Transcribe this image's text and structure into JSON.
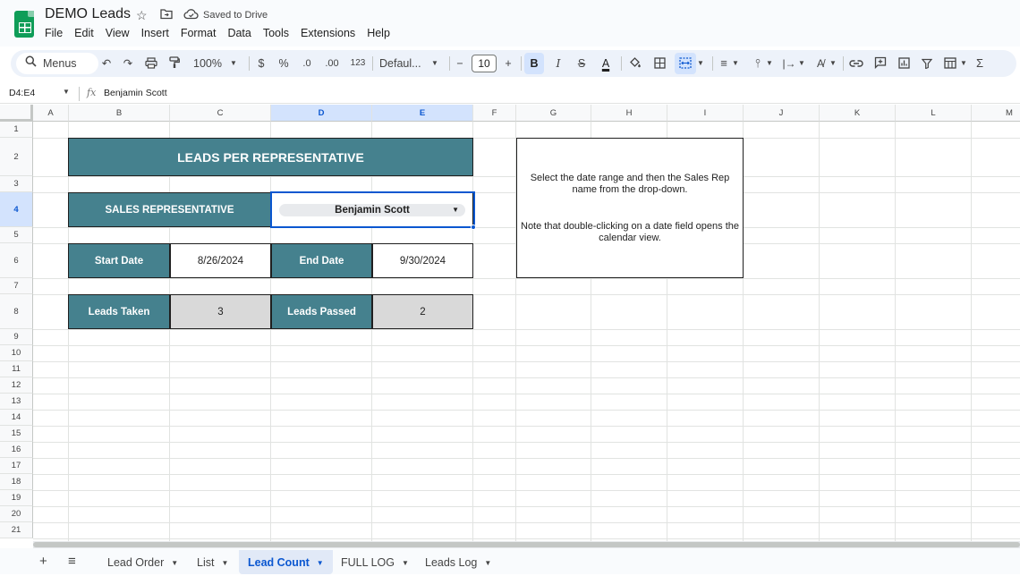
{
  "app": {
    "title": "DEMO Leads",
    "saved_status": "Saved to Drive",
    "icons": [
      "sheets-logo-icon",
      "star-icon",
      "move-folder-icon",
      "cloud-saved-icon"
    ]
  },
  "menu": [
    "File",
    "Edit",
    "View",
    "Insert",
    "Format",
    "Data",
    "Tools",
    "Extensions",
    "Help"
  ],
  "toolbar": {
    "search_label": "Menus",
    "zoom": "100%",
    "currency": "$",
    "percent": "%",
    "dec_decrease": ".0",
    "dec_increase": ".00",
    "number_format": "123",
    "font": "Defaul...",
    "font_size": "10",
    "minus": "−",
    "plus": "+",
    "bold": "B",
    "italic": "I",
    "strike": "S",
    "text_color": "A",
    "sum": "Σ"
  },
  "formula_bar": {
    "name_box": "D4:E4",
    "fx": "fx",
    "value": "Benjamin Scott"
  },
  "columns": [
    "A",
    "B",
    "C",
    "D",
    "E",
    "F",
    "G",
    "H",
    "I",
    "J",
    "K",
    "L",
    "M"
  ],
  "selected_columns": [
    "D",
    "E"
  ],
  "rows": [
    "1",
    "2",
    "3",
    "4",
    "5",
    "6",
    "7",
    "8",
    "9",
    "10",
    "11",
    "12",
    "13",
    "14",
    "15",
    "16",
    "17",
    "18",
    "19",
    "20",
    "21"
  ],
  "selected_row": "4",
  "dashboard": {
    "title": "LEADS PER REPRESENTATIVE",
    "rep_label": "SALES REPRESENTATIVE",
    "rep_value": "Benjamin Scott",
    "start_label": "Start Date",
    "start_value": "8/26/2024",
    "end_label": "End Date",
    "end_value": "9/30/2024",
    "taken_label": "Leads Taken",
    "taken_value": "3",
    "passed_label": "Leads Passed",
    "passed_value": "2"
  },
  "note": {
    "line1": "Select the date range and then the Sales Rep name from the drop-down.",
    "line2": "Note that double-clicking on a date field opens the calendar view."
  },
  "sheet_tabs": [
    {
      "label": "Lead Order",
      "active": false
    },
    {
      "label": "List",
      "active": false
    },
    {
      "label": "Lead Count",
      "active": true
    },
    {
      "label": "FULL LOG",
      "active": false
    },
    {
      "label": "Leads Log",
      "active": false
    }
  ],
  "colors": {
    "teal": "#45818e",
    "grey_cell": "#d9d9d9",
    "selection": "#0b57d0"
  }
}
